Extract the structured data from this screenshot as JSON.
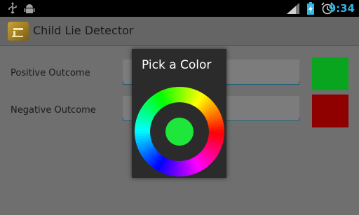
{
  "status_bar": {
    "time": "9:34",
    "icons": [
      "usb-icon",
      "android-debug-icon",
      "signal-icon",
      "battery-charging-icon",
      "alarm-icon"
    ]
  },
  "action_bar": {
    "title": "Child Lie Detector",
    "icon": "app-icon"
  },
  "settings": {
    "positive_label": "Positive Outcome",
    "negative_label": "Negative Outcome",
    "positive_color": "#0aa51e",
    "negative_color": "#8f0000"
  },
  "dialog": {
    "title": "Pick a Color",
    "selected_color": "#1fe63a"
  },
  "colors": {
    "accent": "#33b5e5",
    "dialog_bg": "#2b2b2b"
  }
}
